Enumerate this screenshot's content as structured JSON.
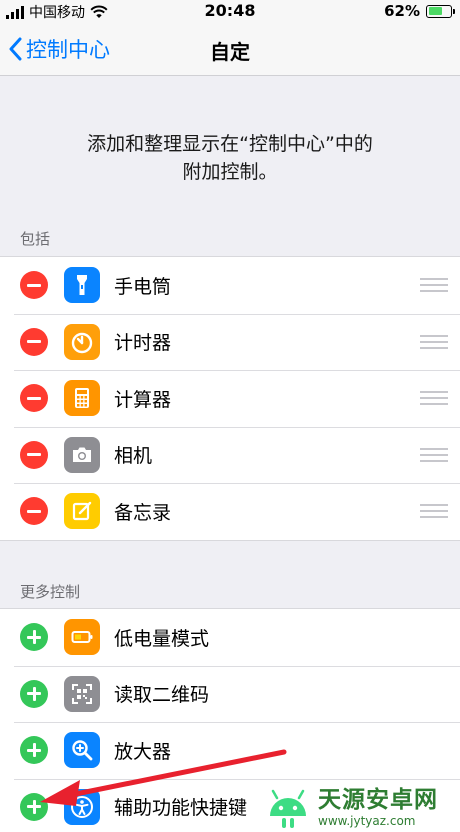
{
  "status": {
    "carrier": "中国移动",
    "time": "20:48",
    "battery_percent": "62%",
    "battery_level": 0.62
  },
  "nav": {
    "back_label": "控制中心",
    "title": "自定"
  },
  "description": {
    "line1": "添加和整理显示在“控制中心”中的",
    "line2": "附加控制。"
  },
  "included": {
    "header": "包括",
    "items": [
      {
        "label": "手电筒",
        "icon": "flashlight-icon",
        "color": "#0a84ff"
      },
      {
        "label": "计时器",
        "icon": "timer-icon",
        "color": "#ff9f0a"
      },
      {
        "label": "计算器",
        "icon": "calculator-icon",
        "color": "#ff9500"
      },
      {
        "label": "相机",
        "icon": "camera-icon",
        "color": "#8e8e93"
      },
      {
        "label": "备忘录",
        "icon": "notes-icon",
        "color": "#ffcc00"
      }
    ]
  },
  "more": {
    "header": "更多控制",
    "items": [
      {
        "label": "低电量模式",
        "icon": "low-power-icon",
        "color": "#ff9500"
      },
      {
        "label": "读取二维码",
        "icon": "qr-code-icon",
        "color": "#8e8e93"
      },
      {
        "label": "放大器",
        "icon": "magnifier-icon",
        "color": "#0a84ff"
      },
      {
        "label": "辅助功能快捷键",
        "icon": "accessibility-icon",
        "color": "#0a84ff"
      }
    ]
  },
  "watermark": {
    "name": "天源安卓网",
    "url": "www.jytyaz.com"
  },
  "colors": {
    "accent": "#007aff",
    "remove": "#ff3b30",
    "add": "#34c759",
    "annotation": "#e8212e"
  }
}
